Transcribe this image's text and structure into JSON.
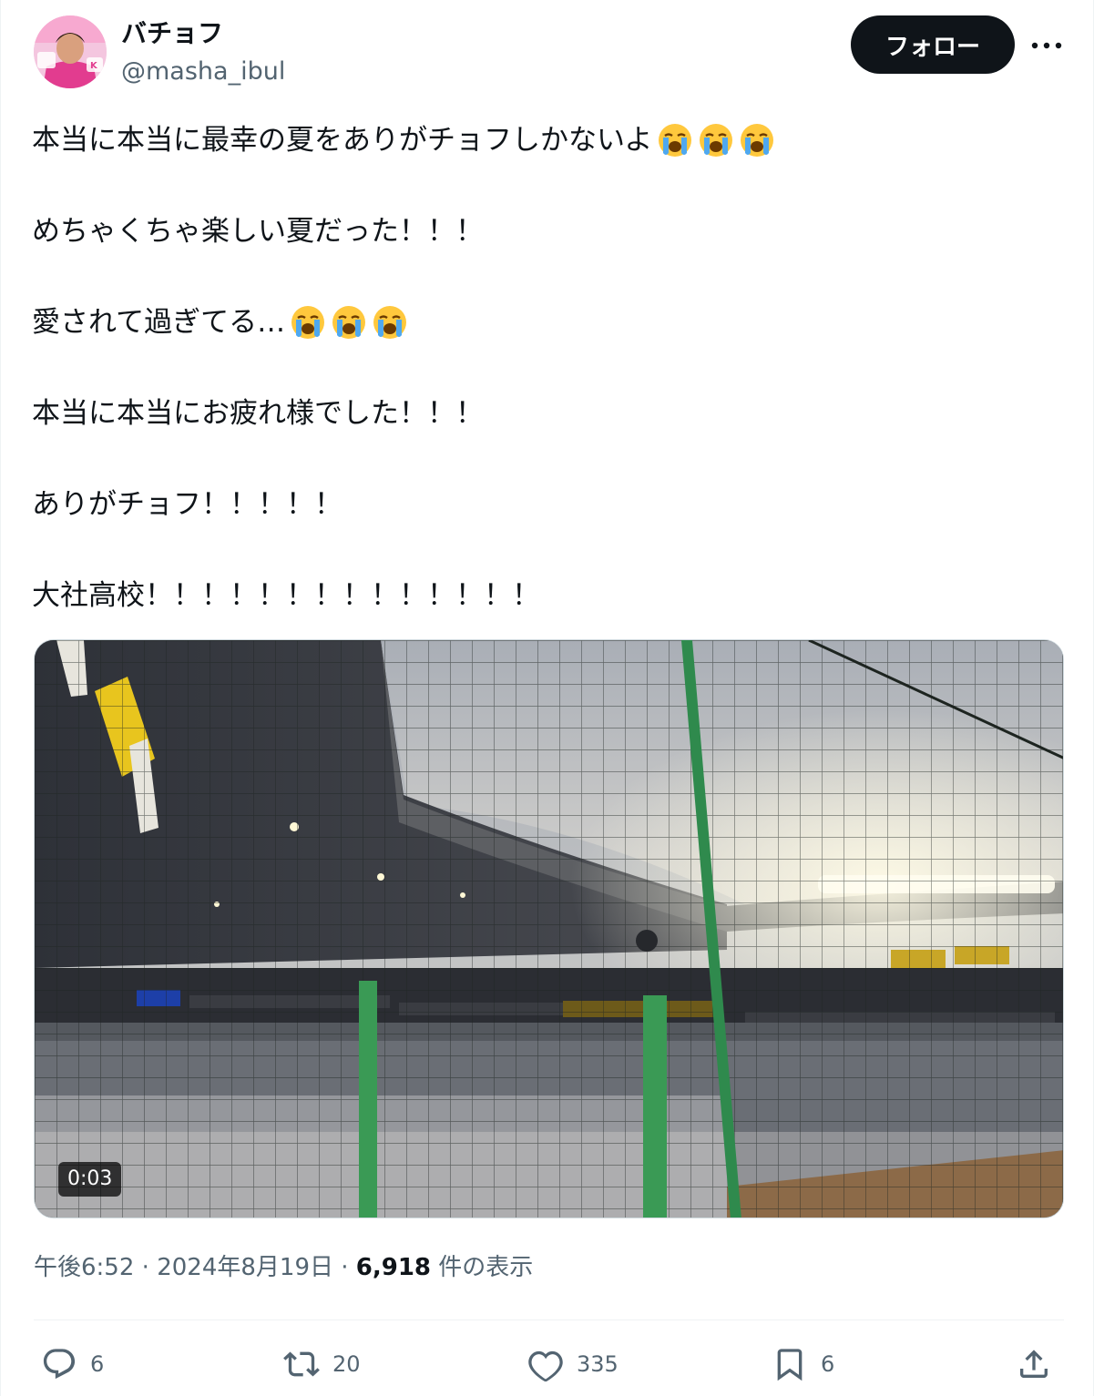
{
  "user": {
    "display_name": "バチョフ",
    "handle": "@masha_ibul",
    "follow_label": "フォロー"
  },
  "tweet": {
    "lines": [
      "本当に本当に最幸の夏をありがチョフしかないよ",
      "めちゃくちゃ楽しい夏だった！！！",
      "愛されて過ぎてる…",
      "本当に本当にお疲れ様でした！！！",
      "ありがチョフ！！！！！",
      "大社高校！！！！！！！！！！！！！！"
    ],
    "emoji": "loudly-crying-face"
  },
  "media": {
    "type": "video",
    "duration": "0:03"
  },
  "meta": {
    "time": "午後6:52",
    "separator": "·",
    "date": "2024年8月19日",
    "views_count": "6,918",
    "views_label": "件の表示"
  },
  "actions": {
    "replies": "6",
    "reposts": "20",
    "likes": "335",
    "bookmarks": "6"
  },
  "colors": {
    "text": "#0f1419",
    "secondary": "#536471",
    "border": "#eff3f4",
    "button_bg": "#0f1419"
  }
}
